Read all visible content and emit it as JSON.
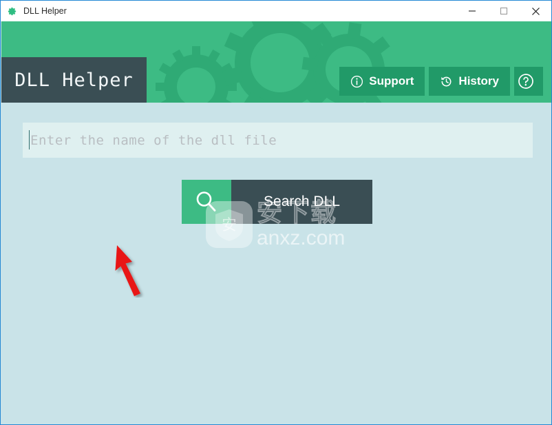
{
  "window": {
    "title": "DLL Helper",
    "app_icon": "gear-icon",
    "controls": {
      "minimize": "minimize-icon",
      "maximize": "maximize-icon",
      "close": "close-icon"
    },
    "border_color": "#2288d4",
    "body_background": "#c9e3e8"
  },
  "header": {
    "background_color": "#3dbb84",
    "gear_decoration_color": "#2faa75",
    "logo": {
      "text": "DLL Helper",
      "background_color": "#3a4e54",
      "text_color": "#f2f6f7"
    },
    "buttons": [
      {
        "label": "Support",
        "icon": "info-circle-icon",
        "color": "#219a68"
      },
      {
        "label": "History",
        "icon": "history-clock-icon",
        "color": "#219a68"
      },
      {
        "label": "",
        "icon": "question-circle-icon",
        "color": "#219a68"
      }
    ]
  },
  "main": {
    "search_field": {
      "value": "",
      "placeholder": "Enter the name of the dll file",
      "background_color": "#dff0f0",
      "placeholder_color": "#b9bec2",
      "caret_visible": true
    },
    "search_button": {
      "label": "Search DLL",
      "icon": "magnifier-icon",
      "icon_pane_color": "#3dbb84",
      "label_pane_color": "#3a4e54",
      "label_color": "#ffffff"
    }
  },
  "watermark": {
    "logo_icon": "shield-badge-icon",
    "cn_text": "安下载",
    "domain": "anxz.com"
  },
  "annotation": {
    "arrow": "red-arrow-pointing-up-left",
    "color": "#e81717"
  }
}
